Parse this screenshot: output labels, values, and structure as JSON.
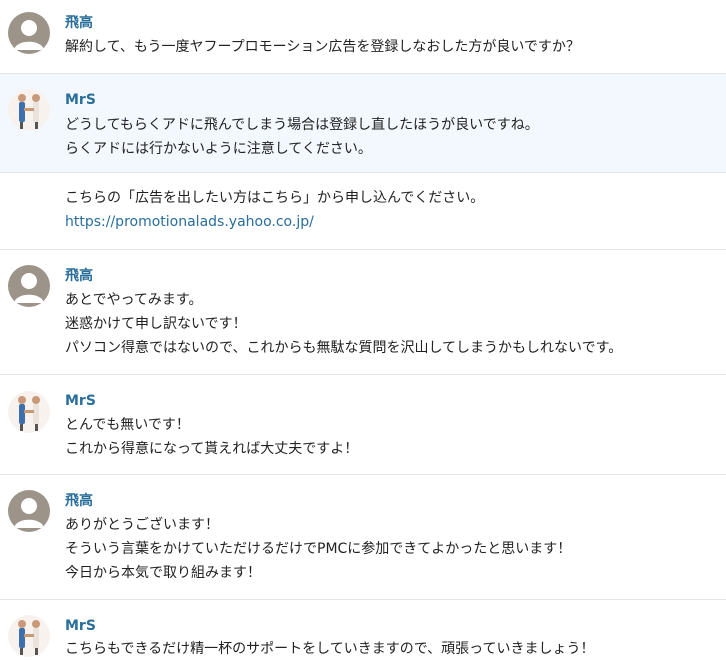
{
  "messages": [
    {
      "sender": "飛高",
      "lines": [
        "解約して、もう一度ヤフープロモーション広告を登録しなおした方が良いですか？"
      ]
    },
    {
      "sender": "MrS",
      "lines": [
        "どうしてもらくアドに飛んでしまう場合は登録し直したほうが良いですね。",
        "らくアドには行かないように注意してください。"
      ]
    },
    {
      "sender": "",
      "lines": [
        "こちらの「広告を出したい方はこちら」から申し込んでください。"
      ],
      "link": "https://promotionalads.yahoo.co.jp/"
    },
    {
      "sender": "飛高",
      "lines": [
        "あとでやってみます。",
        "迷惑かけて申し訳ないです！",
        "パソコン得意ではないので、これからも無駄な質問を沢山してしまうかもしれないです。"
      ]
    },
    {
      "sender": "MrS",
      "lines": [
        "とんでも無いです！",
        "これから得意になって貰えれば大丈夫ですよ！"
      ]
    },
    {
      "sender": "飛高",
      "lines": [
        "ありがとうございます！",
        "そういう言葉をかけていただけるだけでPMCに参加できてよかったと思います！",
        "今日から本気で取り組みます！"
      ]
    },
    {
      "sender": "MrS",
      "lines": [
        "こちらもできるだけ精一杯のサポートをしていきますので、頑張っていきましょう！"
      ]
    }
  ]
}
